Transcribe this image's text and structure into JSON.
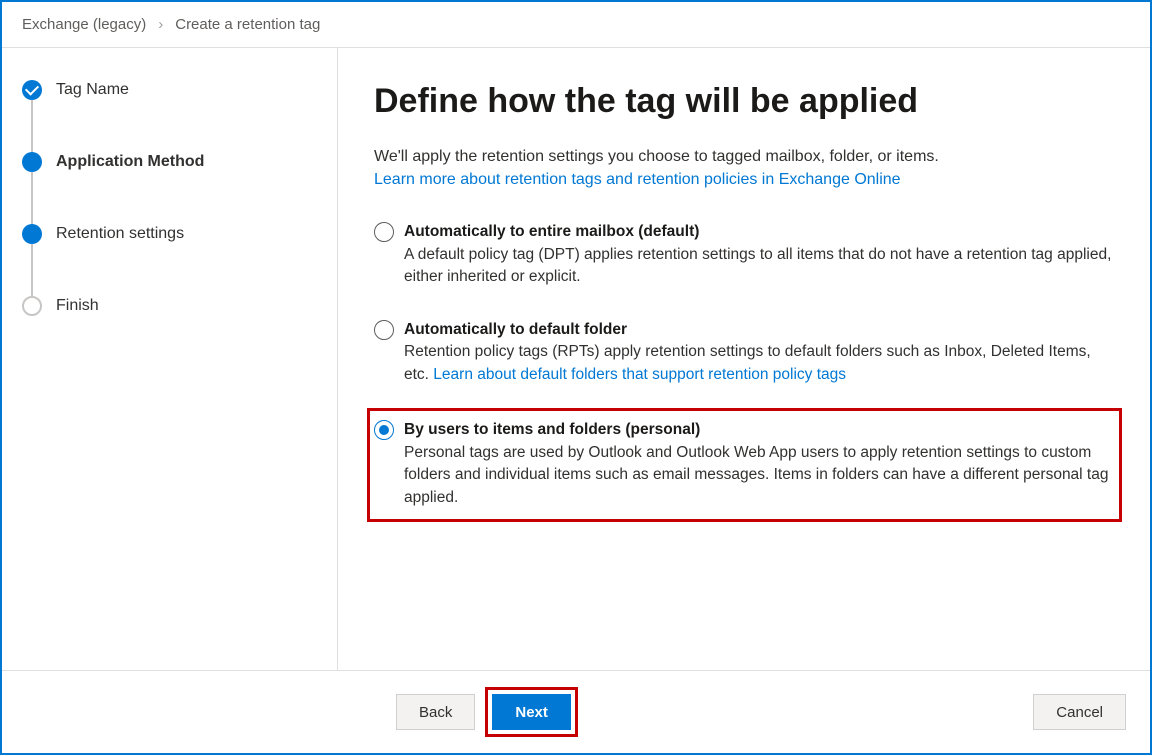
{
  "breadcrumb": {
    "parent": "Exchange (legacy)",
    "current": "Create a retention tag"
  },
  "steps": [
    {
      "label": "Tag Name",
      "state": "completed"
    },
    {
      "label": "Application Method",
      "state": "active"
    },
    {
      "label": "Retention settings",
      "state": "upcoming-filled"
    },
    {
      "label": "Finish",
      "state": "pending"
    }
  ],
  "main": {
    "heading": "Define how the tag will be applied",
    "intro": "We'll apply the retention settings you choose to tagged mailbox, folder, or items.",
    "intro_link": "Learn more about retention tags and retention policies in Exchange Online"
  },
  "options": [
    {
      "title": "Automatically to entire mailbox (default)",
      "desc": "A default policy tag (DPT) applies retention settings to all items that do not have a retention tag applied, either inherited or explicit.",
      "selected": false,
      "link": ""
    },
    {
      "title": "Automatically to default folder",
      "desc": "Retention policy tags (RPTs) apply retention settings to default folders such as Inbox, Deleted Items, etc. ",
      "selected": false,
      "link": "Learn about default folders that support retention policy tags"
    },
    {
      "title": "By users to items and folders (personal)",
      "desc": "Personal tags are used by Outlook and Outlook Web App users to apply retention settings to custom folders and individual items such as email messages. Items in folders can have a different personal tag applied.",
      "selected": true,
      "link": ""
    }
  ],
  "footer": {
    "back": "Back",
    "next": "Next",
    "cancel": "Cancel"
  },
  "highlight_option_index": 2
}
